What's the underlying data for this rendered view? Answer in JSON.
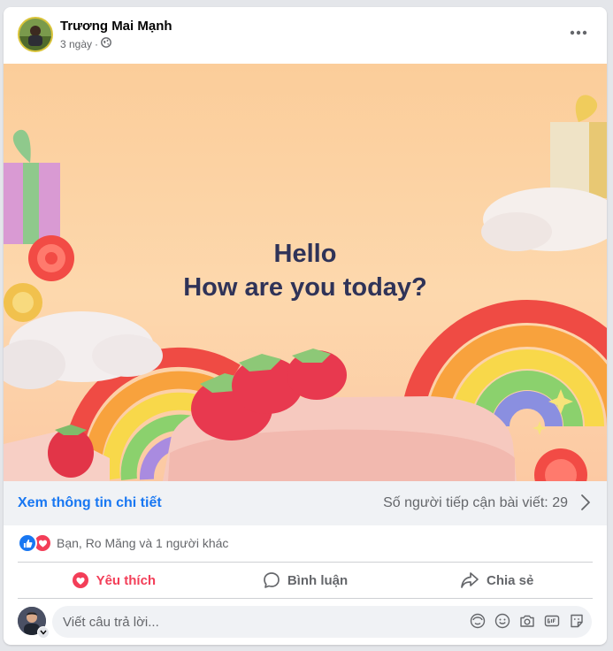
{
  "post": {
    "author": "Trương Mai Mạnh",
    "time": "3 ngày",
    "separator": "·",
    "audience_icon": "globe-icon",
    "more_icon": "more-horizontal-icon"
  },
  "banner": {
    "line1": "Hello",
    "line2": "How are you today?",
    "text_color": "#2f3358",
    "background_color": "#fdd5a8"
  },
  "details": {
    "link_label": "Xem thông tin chi tiết",
    "reach_text": "Số người tiếp cận bài viết: 29",
    "link_color": "#1877f2"
  },
  "reactions": {
    "icons": [
      "like-icon",
      "love-icon"
    ],
    "summary": "Bạn, Ro Măng và 1 người khác"
  },
  "actions": [
    {
      "label": "Yêu thích",
      "icon": "heart-icon",
      "active": true,
      "color": "#f33e58"
    },
    {
      "label": "Bình luận",
      "icon": "comment-icon"
    },
    {
      "label": "Chia sẻ",
      "icon": "share-icon"
    }
  ],
  "comment": {
    "placeholder": "Viết câu trả lời...",
    "icons": [
      "avatar-sticker-icon",
      "emoji-icon",
      "camera-icon",
      "gif-icon",
      "sticker-icon"
    ]
  }
}
